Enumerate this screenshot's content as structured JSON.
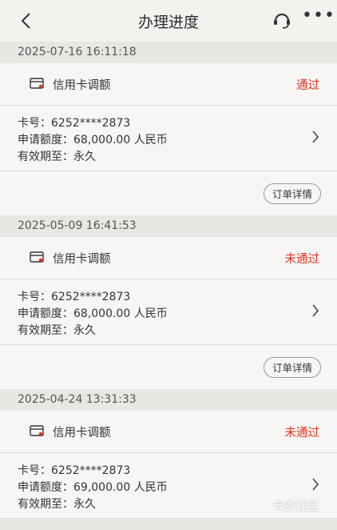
{
  "header": {
    "title": "办理进度",
    "icons": [
      "back-icon",
      "headset-icon",
      "more-icon"
    ]
  },
  "labels": {
    "card_no": "卡号：",
    "amount": "申请额度：",
    "validity": "有效期至："
  },
  "records": [
    {
      "date": "2025-07-16 16:11:18",
      "type": "信用卡调额",
      "status": "通过",
      "card_no": "6252****2873",
      "amount": "68,000.00 人民币",
      "validity": "永久",
      "detail_button": "订单详情"
    },
    {
      "date": "2025-05-09 16:41:53",
      "type": "信用卡调额",
      "status": "未通过",
      "card_no": "6252****2873",
      "amount": "68,000.00 人民币",
      "validity": "永久",
      "detail_button": "订单详情"
    },
    {
      "date": "2025-04-24 13:31:33",
      "type": "信用卡调额",
      "status": "未通过",
      "card_no": "6252****2873",
      "amount": "69,000.00 人民币",
      "validity": "永久"
    }
  ],
  "watermark": "卡农社区",
  "colors": {
    "status_red": "#e0311f",
    "background": "#e9e7e3",
    "card": "#f7f6f4"
  }
}
